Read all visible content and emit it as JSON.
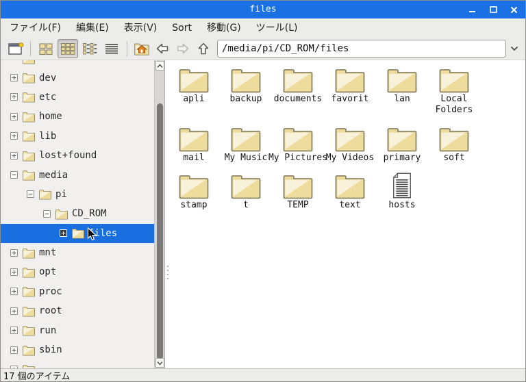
{
  "window": {
    "title": "files"
  },
  "menu_bar": {
    "items": [
      "ファイル(F)",
      "編集(E)",
      "表示(V)",
      "Sort",
      "移動(G)",
      "ツール(L)"
    ]
  },
  "toolbar": {
    "path_value": "/media/pi/CD_ROM/files",
    "icon_names": [
      "new-window-icon",
      "icon-view-icon",
      "small-icon-view-icon",
      "compact-view-icon",
      "detailed-list-icon",
      "home-folder-icon",
      "back-icon",
      "forward-icon",
      "up-icon",
      "path-dropdown-icon"
    ],
    "active_view": "small-icon-view"
  },
  "sidebar": {
    "items": [
      {
        "label": "",
        "level": 0,
        "expander": "",
        "clipped": true
      },
      {
        "label": "dev",
        "level": 0,
        "expander": "+"
      },
      {
        "label": "etc",
        "level": 0,
        "expander": "+"
      },
      {
        "label": "home",
        "level": 0,
        "expander": "+"
      },
      {
        "label": "lib",
        "level": 0,
        "expander": "+"
      },
      {
        "label": "lost+found",
        "level": 0,
        "expander": "+"
      },
      {
        "label": "media",
        "level": 0,
        "expander": "−"
      },
      {
        "label": "pi",
        "level": 1,
        "expander": "−"
      },
      {
        "label": "CD_ROM",
        "level": 2,
        "expander": "−"
      },
      {
        "label": "files",
        "level": 3,
        "expander": "+",
        "selected": true
      },
      {
        "label": "mnt",
        "level": 0,
        "expander": "+"
      },
      {
        "label": "opt",
        "level": 0,
        "expander": "+"
      },
      {
        "label": "proc",
        "level": 0,
        "expander": "+"
      },
      {
        "label": "root",
        "level": 0,
        "expander": "+"
      },
      {
        "label": "run",
        "level": 0,
        "expander": "+"
      },
      {
        "label": "sbin",
        "level": 0,
        "expander": "+"
      },
      {
        "label": "",
        "level": 0,
        "expander": "+",
        "clipped": true
      }
    ]
  },
  "main": {
    "items": [
      {
        "label": "apli",
        "lines": [
          "apli"
        ],
        "type": "folder"
      },
      {
        "label": "backup",
        "lines": [
          "backup"
        ],
        "type": "folder"
      },
      {
        "label": "documents",
        "lines": [
          "documents"
        ],
        "type": "folder"
      },
      {
        "label": "favorit",
        "lines": [
          "favorit"
        ],
        "type": "folder"
      },
      {
        "label": "lan",
        "lines": [
          "lan"
        ],
        "type": "folder"
      },
      {
        "label": "Local Folders",
        "lines": [
          "Local",
          "Folders"
        ],
        "type": "folder"
      },
      {
        "label": "mail",
        "lines": [
          "mail"
        ],
        "type": "folder"
      },
      {
        "label": "My Music",
        "lines": [
          "My Music"
        ],
        "type": "folder"
      },
      {
        "label": "My Pictures",
        "lines": [
          "My Pictures"
        ],
        "type": "folder"
      },
      {
        "label": "My Videos",
        "lines": [
          "My Videos"
        ],
        "type": "folder"
      },
      {
        "label": "primary",
        "lines": [
          "primary"
        ],
        "type": "folder"
      },
      {
        "label": "soft",
        "lines": [
          "soft"
        ],
        "type": "folder"
      },
      {
        "label": "stamp",
        "lines": [
          "stamp"
        ],
        "type": "folder"
      },
      {
        "label": "t",
        "lines": [
          "t"
        ],
        "type": "folder"
      },
      {
        "label": "TEMP",
        "lines": [
          "TEMP"
        ],
        "type": "folder"
      },
      {
        "label": "text",
        "lines": [
          "text"
        ],
        "type": "folder"
      },
      {
        "label": "hosts",
        "lines": [
          "hosts"
        ],
        "type": "file"
      }
    ],
    "rows": [
      6,
      6,
      5
    ]
  },
  "status_bar": {
    "text": "17 個のアイテム"
  },
  "colors": {
    "titlebar": "#1b71e3",
    "selection": "#1a6fe0",
    "toolbar_bg": "#ececeb",
    "sidebar_bg": "#f1f0ef",
    "folder_body": "#eedc9c",
    "folder_highlight": "#f9f2da",
    "folder_border": "#8b8465"
  }
}
